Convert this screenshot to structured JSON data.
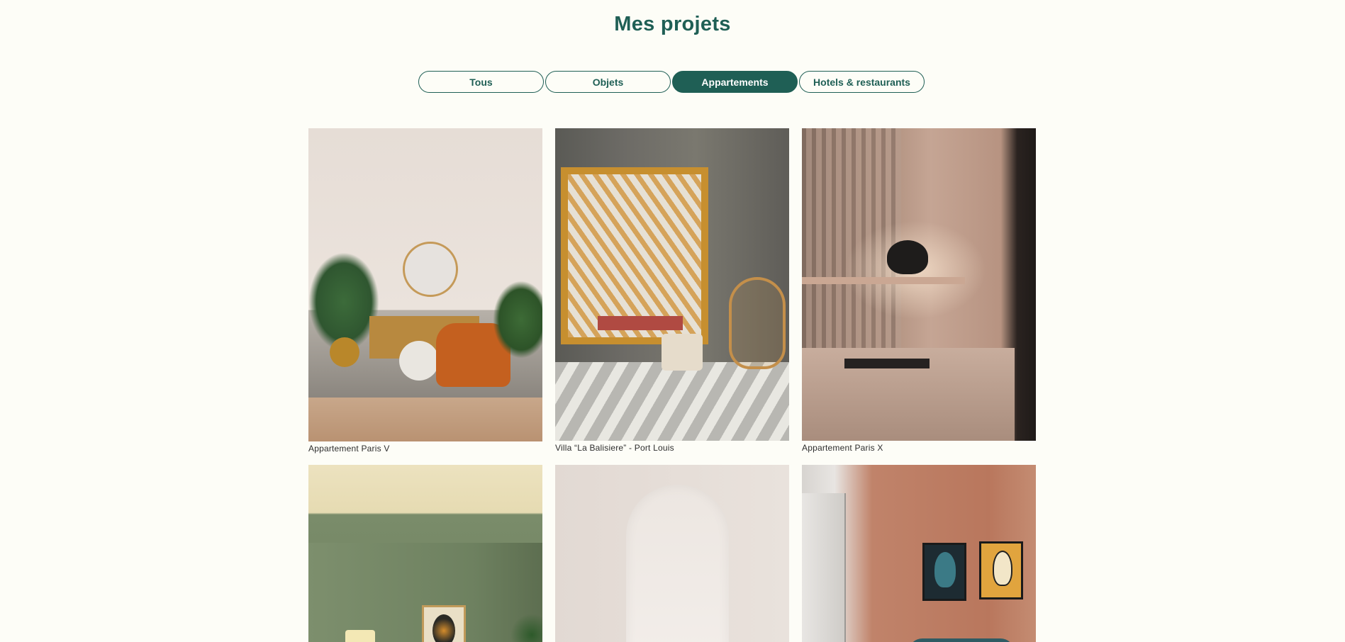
{
  "page": {
    "title": "Mes projets"
  },
  "filters": [
    {
      "label": "Tous",
      "active": false
    },
    {
      "label": "Objets",
      "active": false
    },
    {
      "label": "Appartements",
      "active": true
    },
    {
      "label": "Hotels & restaurants",
      "active": false
    }
  ],
  "projects": [
    {
      "caption": "Appartement Paris V"
    },
    {
      "caption": "Villa “La Balisiere” - Port Louis"
    },
    {
      "caption": "Appartement Paris X"
    },
    {
      "caption": ""
    },
    {
      "caption": ""
    },
    {
      "caption": ""
    }
  ],
  "colors": {
    "accent": "#1f5f55",
    "background": "#fdfdf7"
  }
}
